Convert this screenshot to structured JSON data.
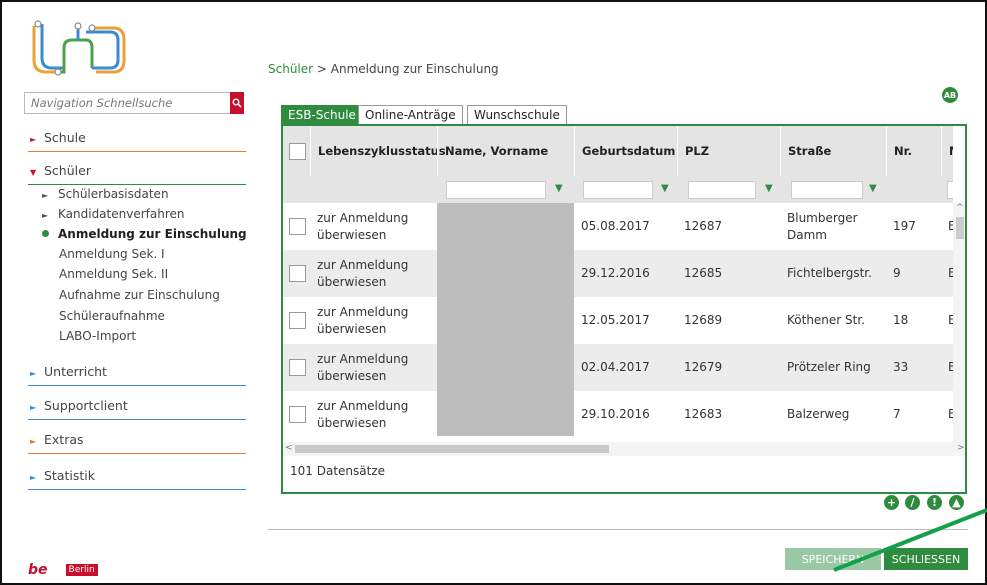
{
  "nav_search": {
    "placeholder": "Navigation Schnellsuche"
  },
  "sidebar": {
    "schule": "Schule",
    "schueler": "Schüler",
    "schueler_items": [
      "Schülerbasisdaten",
      "Kandidatenverfahren",
      "Anmeldung zur Einschulung",
      "Anmeldung Sek. I",
      "Anmeldung Sek. II",
      "Aufnahme zur Einschulung",
      "Schüleraufnahme",
      "LABO-Import"
    ],
    "unterricht": "Unterricht",
    "supportclient": "Supportclient",
    "extras": "Extras",
    "statistik": "Statistik"
  },
  "footer": {
    "brand": "be",
    "city": "Berlin"
  },
  "breadcrumb": {
    "link": "Schüler",
    "sep": ">",
    "current": "Anmeldung zur Einschulung"
  },
  "tabs": [
    "ESB-Schule",
    "Online-Anträge",
    "Wunschschule"
  ],
  "user_icon": "AB",
  "table": {
    "columns": [
      "Lebenszyklusstatus",
      "Name, Vorname",
      "Geburtsdatum",
      "PLZ",
      "Straße",
      "Nr.",
      "M"
    ],
    "rows": [
      {
        "status": "zur Anmeldung überwiesen",
        "date": "05.08.2017",
        "plz": "12687",
        "street": "Blumberger Damm",
        "nr": "197",
        "m": "Ei"
      },
      {
        "status": "zur Anmeldung überwiesen",
        "date": "29.12.2016",
        "plz": "12685",
        "street": "Fichtelbergstr.",
        "nr": "9",
        "m": "Ei"
      },
      {
        "status": "zur Anmeldung überwiesen",
        "date": "12.05.2017",
        "plz": "12689",
        "street": "Köthener Str.",
        "nr": "18",
        "m": "Ei"
      },
      {
        "status": "zur Anmeldung überwiesen",
        "date": "02.04.2017",
        "plz": "12679",
        "street": "Prötzeler Ring",
        "nr": "33",
        "m": "Ei"
      },
      {
        "status": "zur Anmeldung überwiesen",
        "date": "29.10.2016",
        "plz": "12683",
        "street": "Balzerweg",
        "nr": "7",
        "m": "Ei"
      }
    ],
    "record_count": "101 Datensätze"
  },
  "buttons": {
    "save": "SPEICHERN",
    "close": "SCHLIESSEN"
  },
  "colors": {
    "accent": "#2f8c3e",
    "brand_red": "#c8102e",
    "annotation_arrow": "#14a04a"
  }
}
